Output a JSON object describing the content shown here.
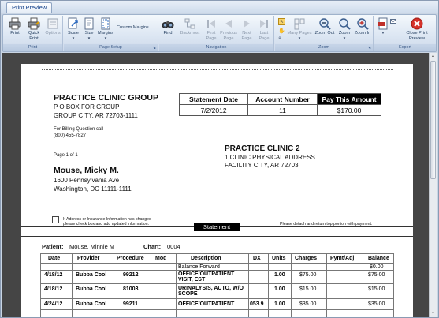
{
  "window": {
    "tab_label": "Print Preview"
  },
  "ribbon": {
    "groups": {
      "print": "Print",
      "page_setup": "Page Setup",
      "navigation": "Navigation",
      "zoom": "Zoom",
      "export": "Export"
    },
    "buttons": {
      "print": "Print",
      "quick_print": "Quick\nPrint",
      "options": "Options",
      "scale": "Scale",
      "size": "Size",
      "margins": "Margins",
      "custom_margins": "Custom Margins...",
      "find": "Find",
      "backmost": "Backmost",
      "first_page": "First\nPage",
      "previous_page": "Previous\nPage",
      "next_page": "Next\nPage",
      "last_page": "Last\nPage",
      "many_pages": "Many Pages",
      "zoom_out": "Zoom Out",
      "zoom": "Zoom",
      "zoom_in": "Zoom In",
      "close_print_preview": "Close Print\nPreview"
    }
  },
  "statement": {
    "clinic_name": "PRACTICE CLINIC GROUP",
    "clinic_address1": "P O BOX FOR GROUP",
    "clinic_address2": "GROUP CITY, AR  72703-1111",
    "billing_label": "For Billing Question call",
    "billing_phone": "(800) 455-7827",
    "page_label": "Page 1 of 1",
    "patient_name": "Mouse, Micky M.",
    "patient_address1": "1600 Pennsylvania Ave",
    "patient_address2": "Washington, DC  11111-1111",
    "insurance_note1": "If Address or Insurance Information has changed",
    "insurance_note2": "please check box and add updated information.",
    "detach_note": "Please detach and return top portion with payment.",
    "remit_name": "PRACTICE CLINIC 2",
    "remit_address1": "1 CLINIC PHYSICAL ADDRESS",
    "remit_address2": "FACILITY CITY, AR  72703",
    "summary_headers": [
      "Statement Date",
      "Account Number",
      "Pay This Amount"
    ],
    "summary_values": [
      "7/2/2012",
      "11",
      "$170.00"
    ],
    "section_label": "Statement",
    "patient_label": "Patient:",
    "patient_value": "Mouse, Minnie M",
    "chart_label": "Chart:",
    "chart_value": "0004"
  },
  "detail_table": {
    "headers": [
      "Date",
      "Provider",
      "Procedure",
      "Mod",
      "Description",
      "DX",
      "Units",
      "Charges",
      "Pymt/Adj",
      "Balance"
    ],
    "balance_forward": {
      "label": "Balance Forward",
      "balance": "$0.00"
    },
    "rows": [
      {
        "date": "4/18/12",
        "provider": "Bubba Cool",
        "procedure": "99212",
        "mod": "",
        "description1": "OFFICE/OUTPATIENT",
        "description2": "VISIT, EST",
        "dx": "",
        "units": "1.00",
        "charges": "$75.00",
        "pymt": "",
        "balance": "$75.00"
      },
      {
        "date": "4/18/12",
        "provider": "Bubba Cool",
        "procedure": "81003",
        "mod": "",
        "description1": "URINALYSIS, AUTO, W/O",
        "description2": "SCOPE",
        "dx": "",
        "units": "1.00",
        "charges": "$15.00",
        "pymt": "",
        "balance": "$15.00"
      },
      {
        "date": "4/24/12",
        "provider": "Bubba Cool",
        "procedure": "99211",
        "mod": "",
        "description1": "OFFICE/OUTPATIENT",
        "description2": "",
        "dx": "053.9",
        "units": "1.00",
        "charges": "$35.00",
        "pymt": "",
        "balance": "$35.00"
      }
    ]
  }
}
